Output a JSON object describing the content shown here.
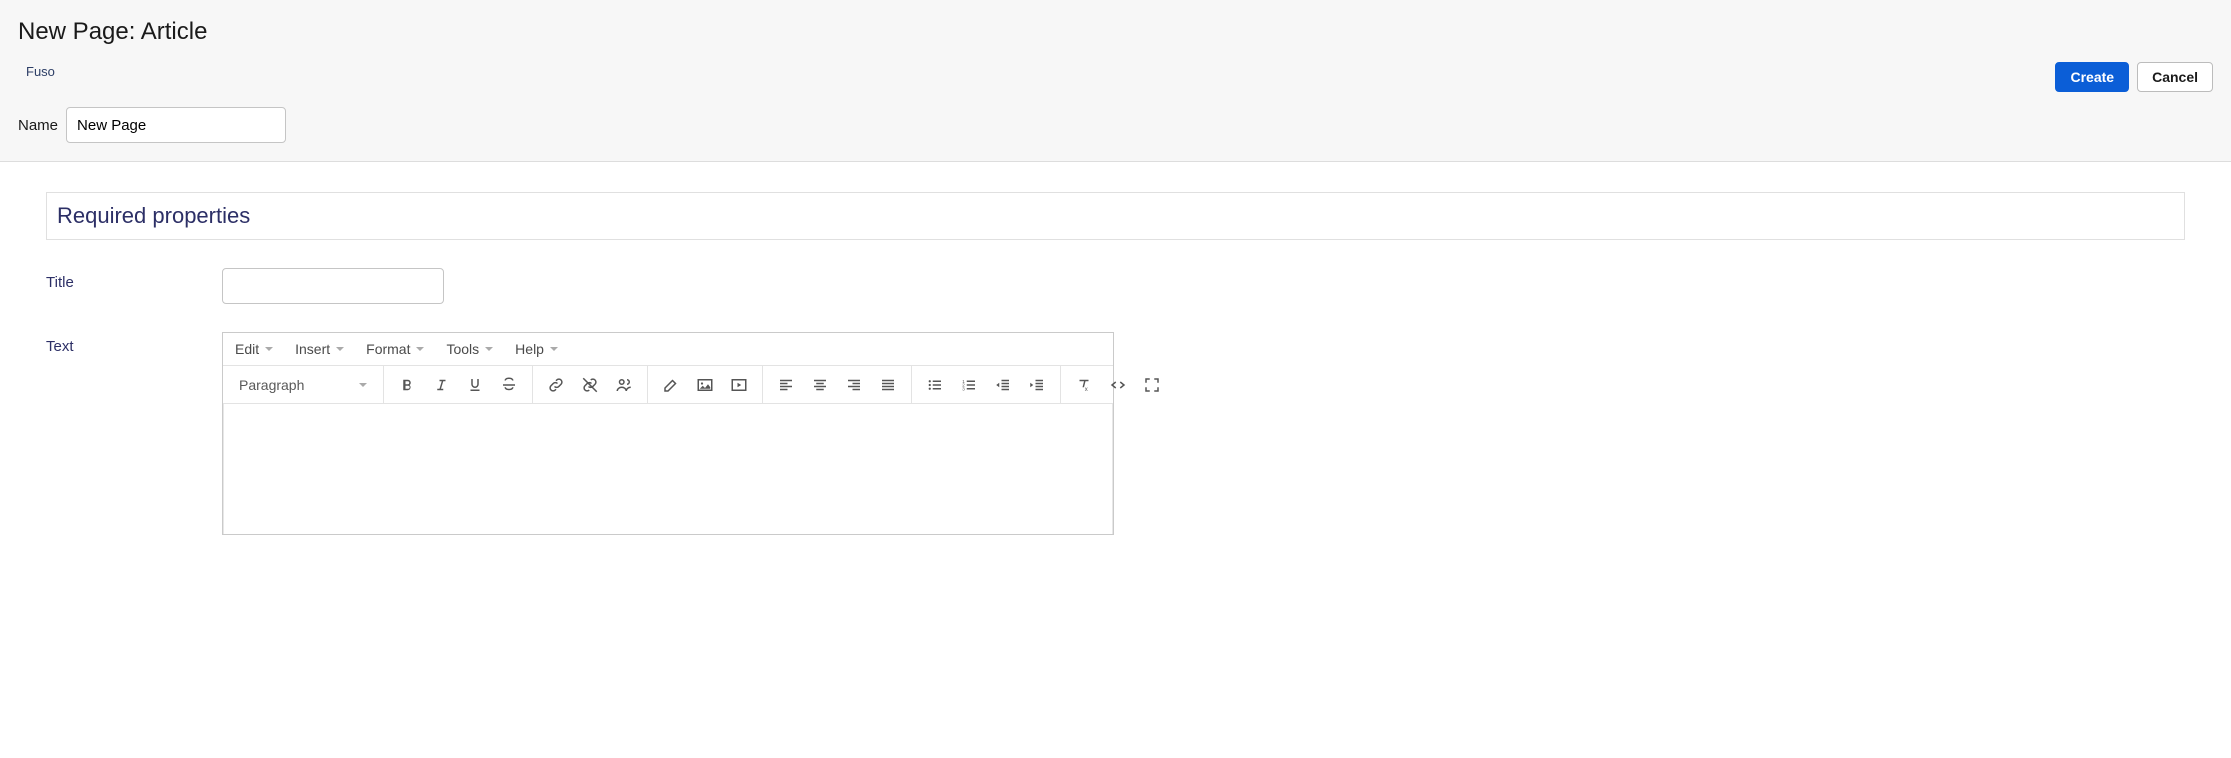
{
  "header": {
    "title": "New Page: Article",
    "breadcrumb": "Fuso",
    "name_label": "Name",
    "name_value": "New Page",
    "create_label": "Create",
    "cancel_label": "Cancel"
  },
  "section": {
    "heading": "Required properties",
    "title_label": "Title",
    "title_value": "",
    "text_label": "Text"
  },
  "editor": {
    "menus": {
      "edit": "Edit",
      "insert": "Insert",
      "format": "Format",
      "tools": "Tools",
      "help": "Help"
    },
    "format_select": "Paragraph"
  }
}
